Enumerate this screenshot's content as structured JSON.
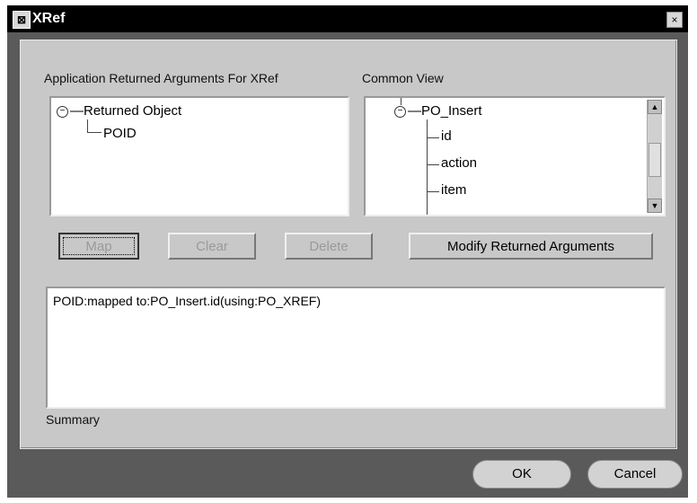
{
  "window": {
    "title": "XRef",
    "icon": "app-icon",
    "close": "×"
  },
  "left_panel": {
    "label": "Application Returned Arguments For XRef",
    "tree": [
      {
        "label": "Returned Object",
        "expander": "−"
      },
      {
        "label": "POID"
      }
    ]
  },
  "right_panel": {
    "label": "Common View",
    "tree": [
      {
        "label": "PO_Insert",
        "expander": "−"
      },
      {
        "label": "id"
      },
      {
        "label": "action"
      },
      {
        "label": "item"
      }
    ]
  },
  "buttons": {
    "map": "Map",
    "clear": "Clear",
    "delete": "Delete",
    "modify": "Modify Returned Arguments"
  },
  "summary": {
    "text": "POID:mapped to:PO_Insert.id(using:PO_XREF)",
    "label": "Summary"
  },
  "footer": {
    "ok": "OK",
    "cancel": "Cancel"
  }
}
